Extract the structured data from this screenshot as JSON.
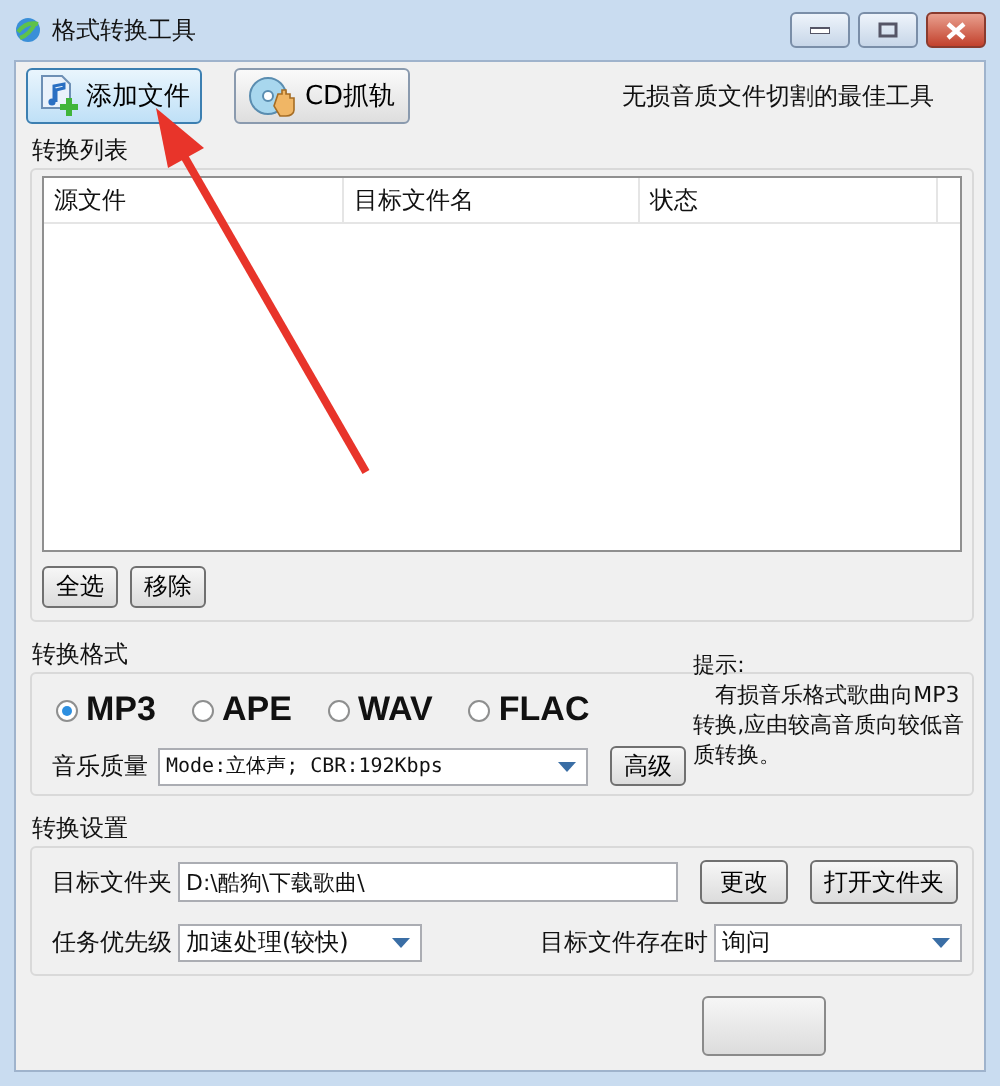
{
  "window": {
    "title": "格式转换工具"
  },
  "toolbar": {
    "buttons": [
      {
        "label": "添加文件",
        "kind": "add",
        "highlighted": true
      },
      {
        "label": "CD抓轨",
        "kind": "cd",
        "highlighted": false
      }
    ],
    "tagline": "无损音质文件切割的最佳工具"
  },
  "conversion_list": {
    "title": "转换列表",
    "columns": [
      "源文件",
      "目标文件名",
      "状态"
    ],
    "buttons": [
      "全选",
      "移除"
    ]
  },
  "format": {
    "title": "转换格式",
    "options": [
      {
        "label": "MP3",
        "selected": true
      },
      {
        "label": "APE",
        "selected": false
      },
      {
        "label": "WAV",
        "selected": false
      },
      {
        "label": "FLAC",
        "selected": false
      }
    ],
    "quality_label": "音乐质量",
    "quality_value": "Mode:立体声; CBR:192Kbps",
    "advanced_button": "高级",
    "hint_title": "提示:",
    "hint_text": "有损音乐格式歌曲向MP3转换,应由较高音质向较低音质转换。"
  },
  "settings": {
    "title": "转换设置",
    "folder_label": "目标文件夹",
    "folder_value": "D:\\酷狗\\下载歌曲\\",
    "change_button": "更改",
    "open_button": "打开文件夹",
    "priority_label": "任务优先级",
    "priority_value": "加速处理(较快)",
    "exists_label": "目标文件存在时",
    "exists_value": "询问"
  }
}
